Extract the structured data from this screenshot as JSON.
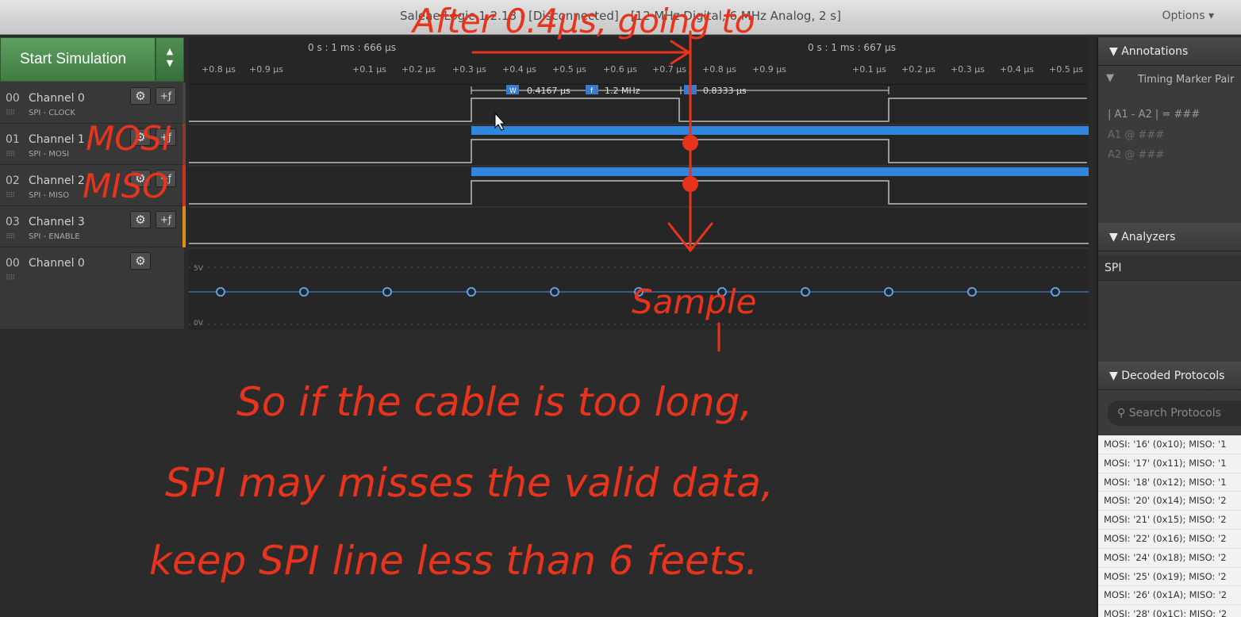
{
  "window": {
    "title": "Saleae Logic 1.2.18 - [Disconnected] - [12 MHz Digital, 6 MHz Analog, 2 s]",
    "options_label": "Options ▾"
  },
  "toolbar": {
    "start_label": "Start Simulation"
  },
  "timeline": {
    "abs_left": "0 s : 1 ms : 666 μs",
    "abs_right": "0 s : 1 ms : 667 μs",
    "ticks": [
      "+0.8 μs",
      "+0.9 μs",
      "+0.1 μs",
      "+0.2 μs",
      "+0.3 μs",
      "+0.4 μs",
      "+0.5 μs",
      "+0.6 μs",
      "+0.7 μs",
      "+0.8 μs",
      "+0.9 μs",
      "+0.1 μs",
      "+0.2 μs",
      "+0.3 μs",
      "+0.4 μs",
      "+0.5 μs"
    ]
  },
  "channels": [
    {
      "num": "00",
      "name": "Channel 0",
      "sub": "SPI - CLOCK",
      "color": "#444444"
    },
    {
      "num": "01",
      "name": "Channel 1",
      "sub": "SPI - MOSI",
      "color": "#8a3a2a"
    },
    {
      "num": "02",
      "name": "Channel 2",
      "sub": "SPI - MISO",
      "color": "#d03020"
    },
    {
      "num": "03",
      "name": "Channel 3",
      "sub": "SPI - ENABLE",
      "color": "#e08a18"
    },
    {
      "num": "00",
      "name": "Channel 0",
      "sub": "",
      "color": "#444444"
    }
  ],
  "measure": {
    "width": "0.4167 μs",
    "freq": "1.2 MHz",
    "period": "0.8333 μs",
    "w_badge": "W",
    "f_badge": "f"
  },
  "analog": {
    "v_high": "5V",
    "v_low": "0V"
  },
  "right_panel": {
    "annotations_head": "▼ Annotations",
    "timing_pair": "Timing Marker Pair",
    "marker_line1": "| A1 - A2 | = ###",
    "marker_line2": "A1 @ ###",
    "marker_line3": "A2 @ ###",
    "analyzers_head": "▼ Analyzers",
    "spi_label": "SPI",
    "decoded_head": "▼ Decoded Protocols",
    "search_placeholder": "Search Protocols",
    "decoded_rows": [
      "MOSI: '16' (0x10);  MISO: '1",
      "MOSI: '17' (0x11);  MISO: '1",
      "MOSI: '18' (0x12);  MISO: '1",
      "MOSI: '20' (0x14);  MISO: '2",
      "MOSI: '21' (0x15);  MISO: '2",
      "MOSI: '22' (0x16);  MISO: '2",
      "MOSI: '24' (0x18);  MISO: '2",
      "MOSI: '25' (0x19);  MISO: '2",
      "MOSI: '26' (0x1A);  MISO: '2",
      "MOSI: '28' (0x1C);  MISO: '2"
    ]
  },
  "annotations": {
    "top": "After 0.4μs, going to",
    "mosi": "MOSI",
    "miso": "MISO",
    "sample": "Sample",
    "line1": "So if the cable is too long,",
    "line2": "SPI may misses the valid data,",
    "line3": "keep SPI line less than 6 feets."
  }
}
